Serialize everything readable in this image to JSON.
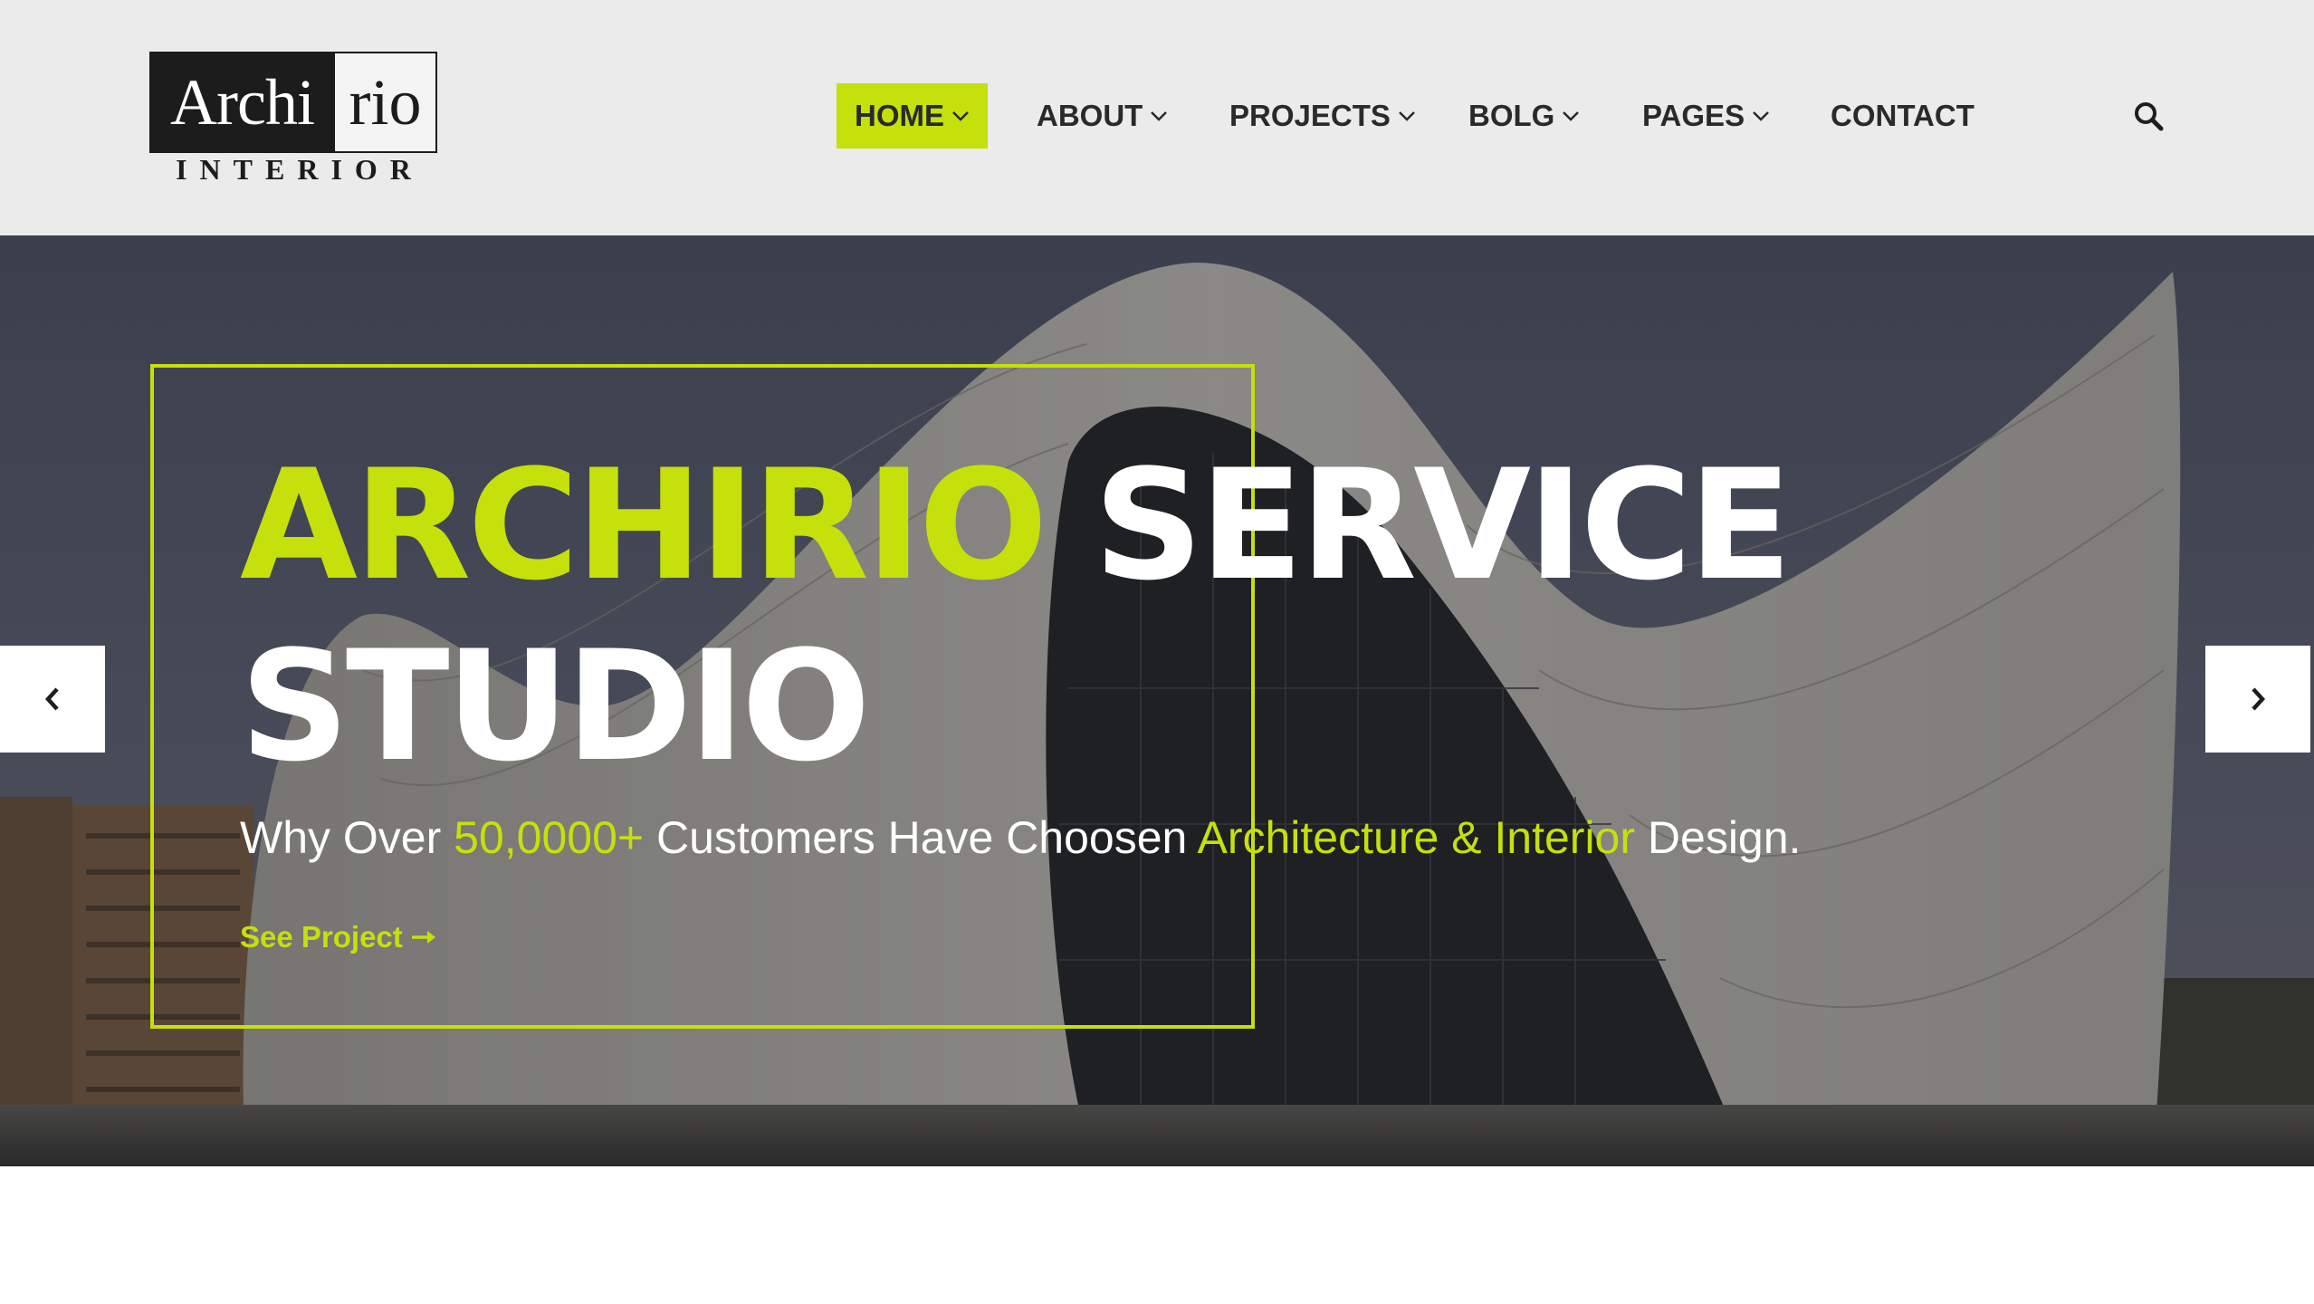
{
  "logo": {
    "left_text": "Archi",
    "right_text": "rio",
    "subtitle": "INTERIOR"
  },
  "nav": {
    "items": [
      {
        "label": "HOME",
        "has_dropdown": true,
        "active": true
      },
      {
        "label": "ABOUT",
        "has_dropdown": true,
        "active": false
      },
      {
        "label": "PROJECTS",
        "has_dropdown": true,
        "active": false
      },
      {
        "label": "BOLG",
        "has_dropdown": true,
        "active": false
      },
      {
        "label": "PAGES",
        "has_dropdown": true,
        "active": false
      },
      {
        "label": "CONTACT",
        "has_dropdown": false,
        "active": false
      }
    ],
    "search_icon": "search-icon"
  },
  "hero": {
    "title_highlight": "ARCHIRIO",
    "title_rest": " SERVICE",
    "title_line2": "STUDIO",
    "subtitle_part1": "Why Over ",
    "subtitle_highlight1": "50,0000+",
    "subtitle_part2": " Customers Have Choosen ",
    "subtitle_highlight2": "Architecture & Interior",
    "subtitle_part3": " Design.",
    "cta_label": "See Project",
    "cta_icon": "arrow-right-icon",
    "prev_icon": "chevron-left-icon",
    "next_icon": "chevron-right-icon"
  },
  "colors": {
    "accent": "#c5e00b",
    "header_bg": "#ebebeb",
    "text_dark": "#2a2a2a"
  }
}
